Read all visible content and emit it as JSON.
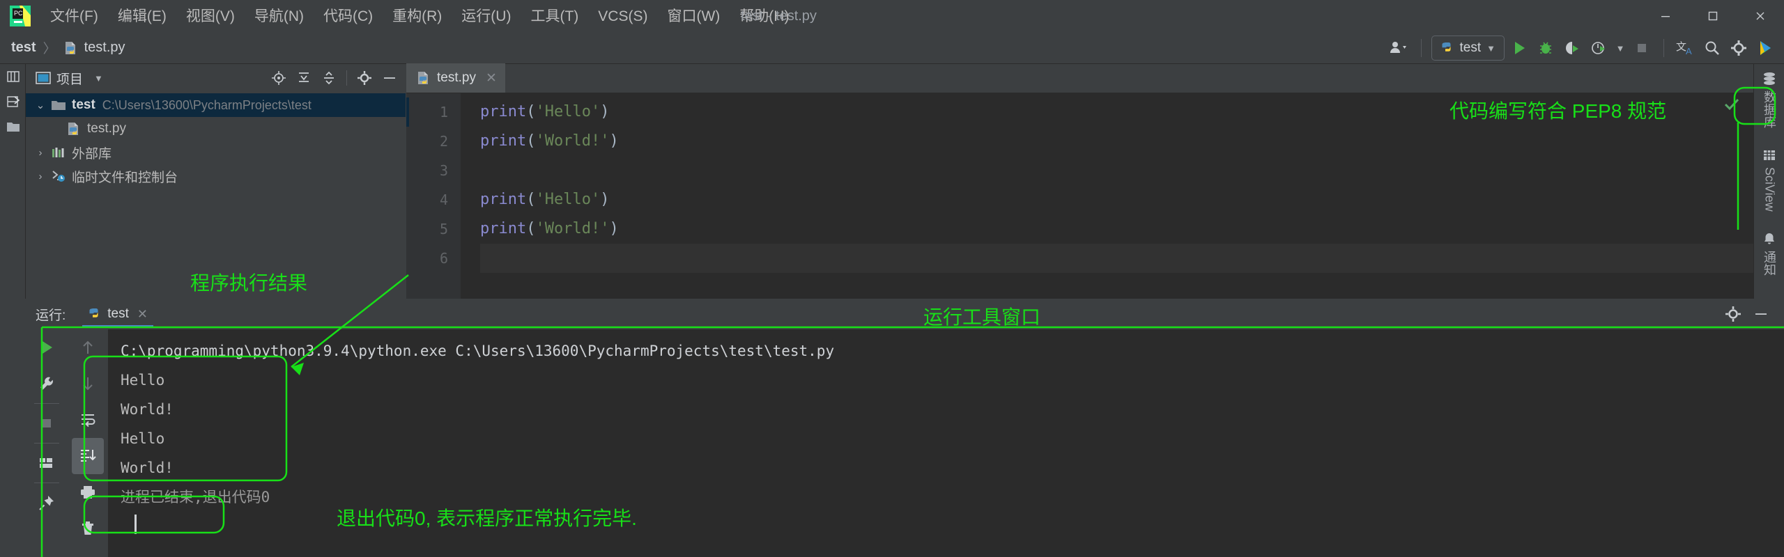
{
  "app": {
    "window_title": "test - test.py",
    "logo_name": "pycharm-logo"
  },
  "menubar": {
    "items": [
      {
        "label": "文件(F)",
        "name": "menu-file"
      },
      {
        "label": "编辑(E)",
        "name": "menu-edit"
      },
      {
        "label": "视图(V)",
        "name": "menu-view"
      },
      {
        "label": "导航(N)",
        "name": "menu-navigate"
      },
      {
        "label": "代码(C)",
        "name": "menu-code"
      },
      {
        "label": "重构(R)",
        "name": "menu-refactor"
      },
      {
        "label": "运行(U)",
        "name": "menu-run"
      },
      {
        "label": "工具(T)",
        "name": "menu-tools"
      },
      {
        "label": "VCS(S)",
        "name": "menu-vcs"
      },
      {
        "label": "窗口(W)",
        "name": "menu-window"
      },
      {
        "label": "帮助(H)",
        "name": "menu-help"
      }
    ],
    "minimize": "—",
    "maximize": "☐",
    "close": "✕"
  },
  "navbar": {
    "breadcrumb": [
      {
        "label": "test",
        "name": "breadcrumb-project"
      },
      {
        "label": "test.py",
        "name": "breadcrumb-file"
      }
    ],
    "separator": "〉",
    "run_config": "test",
    "toolbar_icons": [
      "account-icon",
      "run-icon",
      "debug-icon",
      "coverage-icon",
      "profile-icon",
      "stop-icon",
      "translate-icon",
      "search-icon",
      "settings-icon",
      "ide-features-icon"
    ]
  },
  "left_strip": {
    "items": [
      "structure-icon",
      "bookmarks-icon",
      "project-folder-icon"
    ]
  },
  "project_panel": {
    "title": "项目",
    "header_icons": [
      "locate-icon",
      "expand-all-icon",
      "collapse-all-icon",
      "gear-icon",
      "hide-icon"
    ],
    "tree": [
      {
        "label": "test",
        "path": "C:\\Users\\13600\\PycharmProjects\\test",
        "icon": "folder-icon",
        "twisty": "⌄",
        "selected": true,
        "indent": 0
      },
      {
        "label": "test.py",
        "path": "",
        "icon": "python-file-icon",
        "twisty": "",
        "selected": false,
        "indent": 1
      },
      {
        "label": "外部库",
        "path": "",
        "icon": "library-icon",
        "twisty": "›",
        "selected": false,
        "indent": 0
      },
      {
        "label": "临时文件和控制台",
        "path": "",
        "icon": "scratches-icon",
        "twisty": "›",
        "selected": false,
        "indent": 0
      }
    ]
  },
  "editor": {
    "tab": {
      "label": "test.py",
      "icon": "python-file-icon",
      "close": "✕"
    },
    "lines": [
      {
        "no": "1",
        "tokens": [
          {
            "t": "print",
            "c": "kw-fn"
          },
          {
            "t": "(",
            "c": "punc"
          },
          {
            "t": "'Hello'",
            "c": "str"
          },
          {
            "t": ")",
            "c": "punc"
          }
        ]
      },
      {
        "no": "2",
        "tokens": [
          {
            "t": "print",
            "c": "kw-fn"
          },
          {
            "t": "(",
            "c": "punc"
          },
          {
            "t": "'World!'",
            "c": "str"
          },
          {
            "t": ")",
            "c": "punc"
          }
        ]
      },
      {
        "no": "3",
        "tokens": []
      },
      {
        "no": "4",
        "tokens": [
          {
            "t": "print",
            "c": "kw-fn"
          },
          {
            "t": "(",
            "c": "punc"
          },
          {
            "t": "'Hello'",
            "c": "str"
          },
          {
            "t": ")",
            "c": "punc"
          }
        ]
      },
      {
        "no": "5",
        "tokens": [
          {
            "t": "print",
            "c": "kw-fn"
          },
          {
            "t": "(",
            "c": "punc"
          },
          {
            "t": "'World!'",
            "c": "str"
          },
          {
            "t": ")",
            "c": "punc"
          }
        ]
      },
      {
        "no": "6",
        "tokens": []
      }
    ],
    "inspection_badge": "check-icon"
  },
  "right_strip": {
    "items": [
      {
        "label": "数据库",
        "icon": "database-icon",
        "vertical": "upright"
      },
      {
        "label": "SciView",
        "icon": "sciview-icon",
        "vertical": "mixed"
      },
      {
        "label": "通知",
        "icon": "bell-icon",
        "vertical": "upright"
      }
    ]
  },
  "run_window": {
    "label": "运行:",
    "tab": {
      "label": "test",
      "icon": "python-icon",
      "close": "✕"
    },
    "header_icons": [
      "gear-icon",
      "hide-icon"
    ],
    "rail_icons": [
      "run-icon",
      "wrench-icon",
      "stop-icon",
      "layout-icon",
      "pin-icon"
    ],
    "gutter_icons": [
      "scroll-up-icon",
      "scroll-down-icon",
      "soft-wrap-icon",
      "scroll-to-end-icon",
      "print-icon",
      "trash-icon"
    ],
    "console": {
      "command": "C:\\programming\\python3.9.4\\python.exe C:\\Users\\13600\\PycharmProjects\\test\\test.py",
      "output": [
        "Hello",
        "World!",
        "Hello",
        "World!"
      ],
      "exit_message": "进程已结束,退出代码0"
    }
  },
  "annotations": {
    "pep8": "代码编写符合 PEP8 规范",
    "program_result": "程序执行结果",
    "run_tool_window": "运行工具窗口",
    "exit_code": "退出代码0, 表示程序正常执行完毕.",
    "color": "#18e018"
  }
}
